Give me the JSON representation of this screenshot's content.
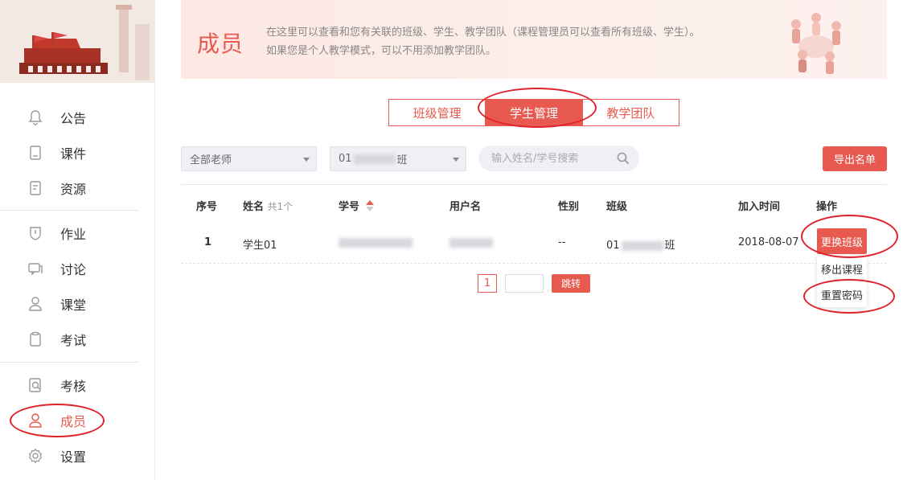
{
  "sidebar": {
    "items": [
      {
        "label": "公告",
        "icon": "bell-icon"
      },
      {
        "label": "课件",
        "icon": "book-icon"
      },
      {
        "label": "资源",
        "icon": "resource-icon"
      },
      {
        "label": "作业",
        "icon": "shield-icon"
      },
      {
        "label": "讨论",
        "icon": "chat-icon"
      },
      {
        "label": "课堂",
        "icon": "classroom-icon"
      },
      {
        "label": "考试",
        "icon": "clipboard-icon"
      },
      {
        "label": "考核",
        "icon": "search-doc-icon"
      },
      {
        "label": "成员",
        "icon": "person-icon",
        "active": true
      },
      {
        "label": "设置",
        "icon": "gear-icon"
      }
    ]
  },
  "header": {
    "title": "成员",
    "desc_line1": "在这里可以查看和您有关联的班级、学生、教学团队（课程管理员可以查看所有班级、学生）。",
    "desc_line2": "如果您是个人教学模式，可以不用添加教学团队。"
  },
  "tabs": [
    {
      "label": "班级管理"
    },
    {
      "label": "学生管理",
      "active": true
    },
    {
      "label": "教学团队"
    }
  ],
  "filters": {
    "teacher_select": "全部老师",
    "class_prefix": "01",
    "class_suffix": "班",
    "search_placeholder": "输入姓名/学号搜索",
    "export_label": "导出名单"
  },
  "table": {
    "headers": {
      "index": "序号",
      "name": "姓名",
      "name_count": "共1个",
      "student_id": "学号",
      "username": "用户名",
      "gender": "性别",
      "class": "班级",
      "join_time": "加入时间",
      "ops": "操作"
    },
    "rows": [
      {
        "index": "1",
        "name": "学生01",
        "gender": "--",
        "class_prefix": "01",
        "class_suffix": "班",
        "join_time": "2018-08-07"
      }
    ],
    "ops": {
      "change_class": "更换班级",
      "remove_course": "移出课程",
      "reset_password": "重置密码"
    }
  },
  "pager": {
    "current": "1",
    "jump_label": "跳转"
  },
  "colors": {
    "accent": "#e85a4f",
    "annotation": "#e0222a"
  }
}
